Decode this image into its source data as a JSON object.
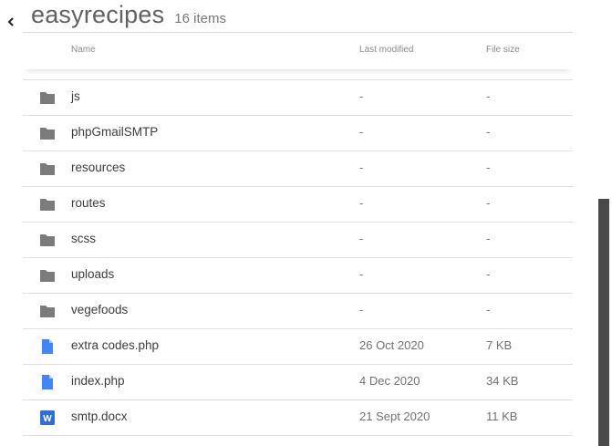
{
  "header": {
    "back_icon": "chevron-left-icon",
    "folder_title": "easyrecipes",
    "item_count": "16 items"
  },
  "columns": {
    "name": "Name",
    "last_modified": "Last modified",
    "file_size": "File size"
  },
  "items": [
    {
      "name": "js",
      "modified": "-",
      "size": "-",
      "icon": "folder-icon"
    },
    {
      "name": "phpGmailSMTP",
      "modified": "-",
      "size": "-",
      "icon": "folder-icon"
    },
    {
      "name": "resources",
      "modified": "-",
      "size": "-",
      "icon": "folder-icon"
    },
    {
      "name": "routes",
      "modified": "-",
      "size": "-",
      "icon": "folder-icon"
    },
    {
      "name": "scss",
      "modified": "-",
      "size": "-",
      "icon": "folder-icon"
    },
    {
      "name": "uploads",
      "modified": "-",
      "size": "-",
      "icon": "folder-icon"
    },
    {
      "name": "vegefoods",
      "modified": "-",
      "size": "-",
      "icon": "folder-icon"
    },
    {
      "name": "extra codes.php",
      "modified": "26 Oct 2020",
      "size": "7 KB",
      "icon": "file-icon"
    },
    {
      "name": "index.php",
      "modified": "4 Dec 2020",
      "size": "34 KB",
      "icon": "file-icon"
    },
    {
      "name": "smtp.docx",
      "modified": "21 Sept 2020",
      "size": "11 KB",
      "icon": "word-doc-icon"
    }
  ],
  "colors": {
    "folder": "#7b7b7b",
    "file": "#4285f4",
    "word": "#2f6fd6",
    "scrollbar": "#4a4a4a"
  }
}
